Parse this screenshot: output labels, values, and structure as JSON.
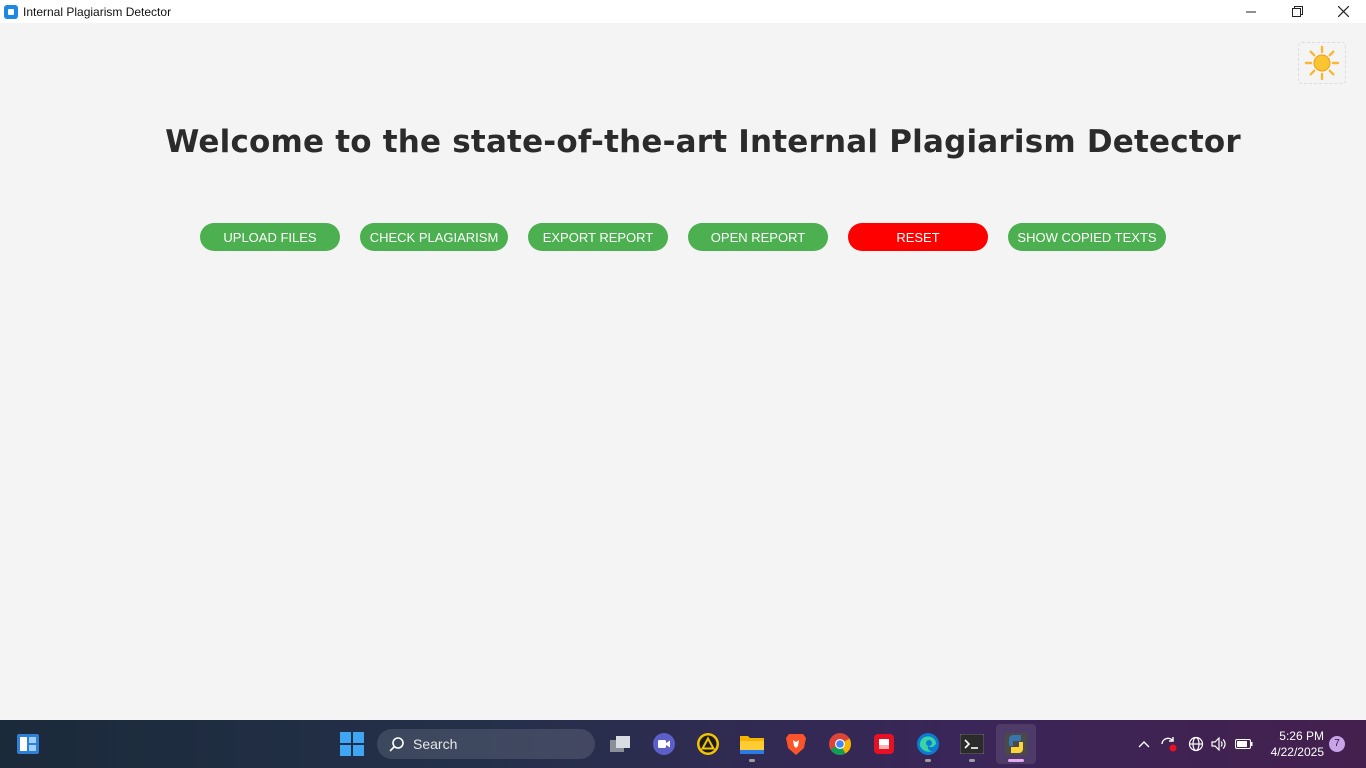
{
  "window": {
    "title": "Internal Plagiarism Detector"
  },
  "theme_toggle": {
    "icon": "sun-icon"
  },
  "main": {
    "heading": "Welcome to the state-of-the-art Internal Plagiarism Detector",
    "buttons": [
      {
        "label": "UPLOAD FILES",
        "color": "#4caf50"
      },
      {
        "label": "CHECK PLAGIARISM",
        "color": "#4caf50"
      },
      {
        "label": "EXPORT REPORT",
        "color": "#4caf50"
      },
      {
        "label": "OPEN REPORT",
        "color": "#4caf50"
      },
      {
        "label": "RESET",
        "color": "#ff0000"
      },
      {
        "label": "SHOW COPIED TEXTS",
        "color": "#4caf50"
      }
    ]
  },
  "taskbar": {
    "search_label": "Search",
    "time": "5:26 PM",
    "date": "4/22/2025",
    "notification_count": "7",
    "apps": [
      "task-view",
      "meet",
      "app-triangle",
      "file-explorer",
      "brave",
      "chrome",
      "app-red",
      "edge",
      "terminal",
      "python"
    ]
  }
}
